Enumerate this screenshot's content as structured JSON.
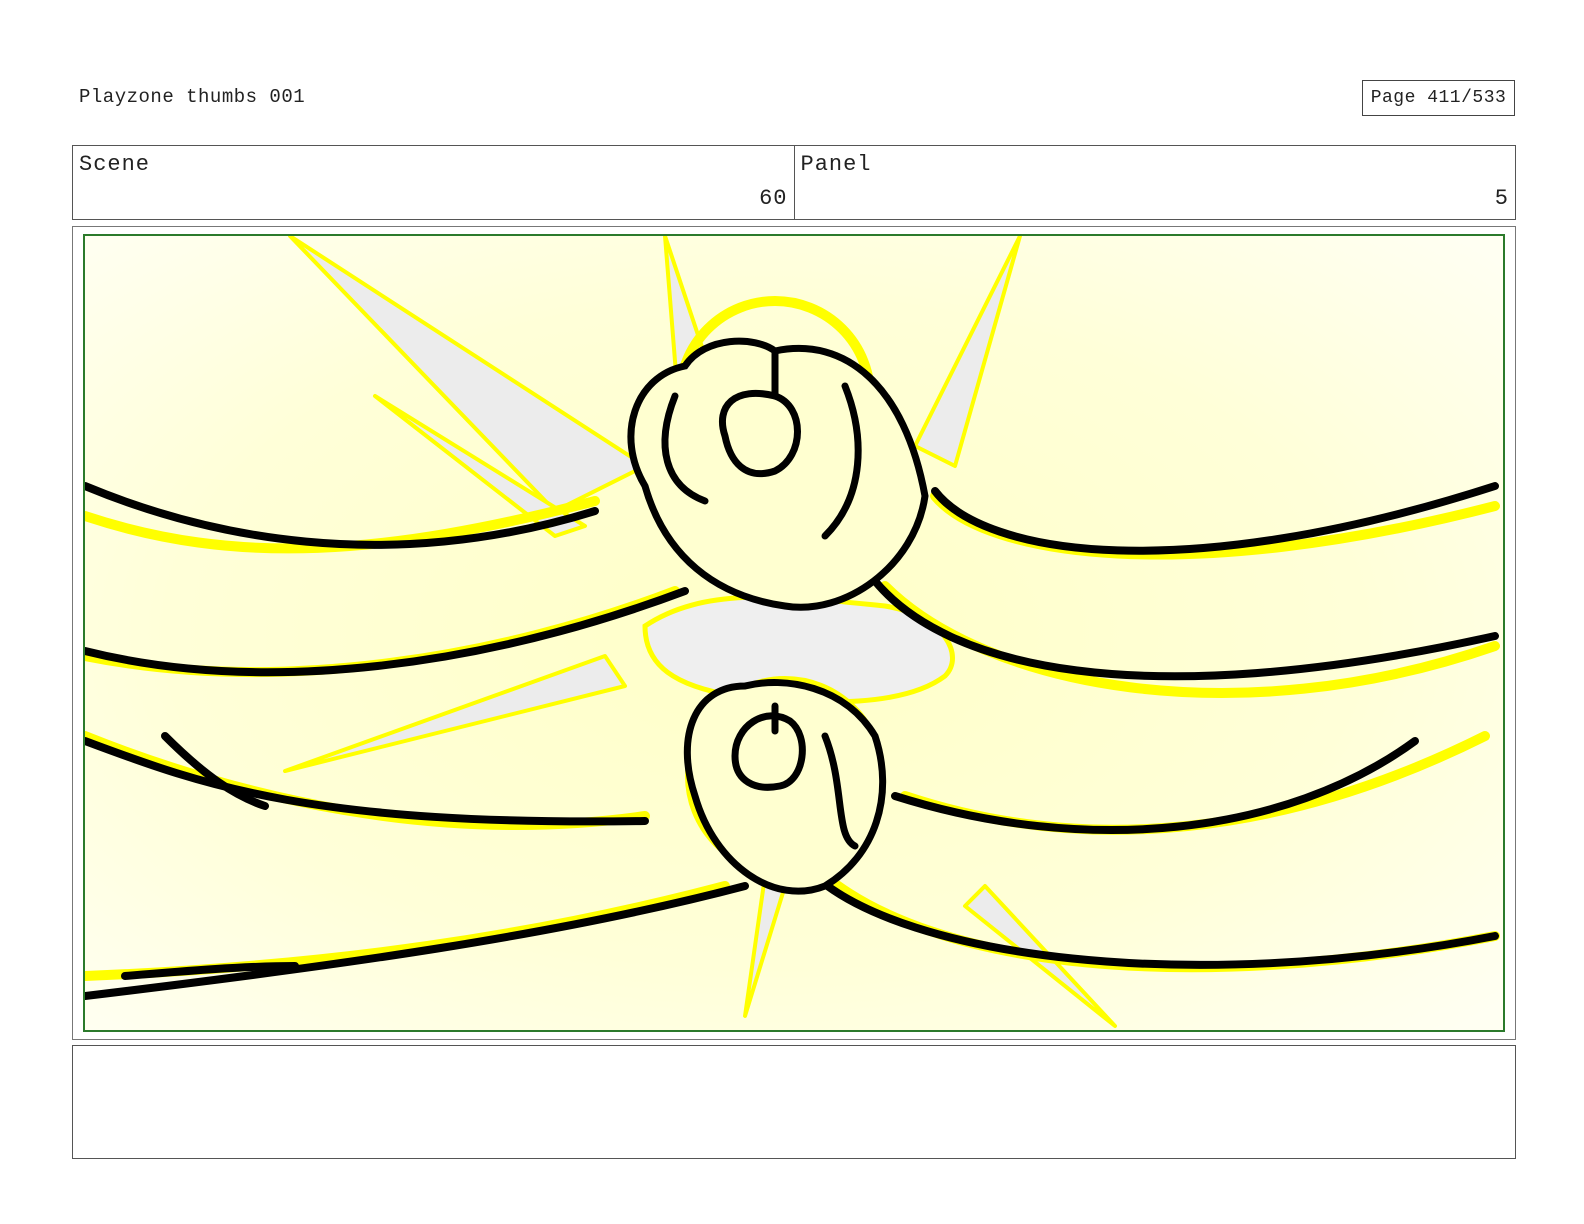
{
  "header": {
    "title": "Playzone thumbs 001",
    "page_label": "Page 411/533"
  },
  "info": {
    "scene_label": "Scene",
    "scene_value": "60",
    "panel_label": "Panel",
    "panel_value": "5"
  },
  "panel_art": {
    "description_icon": "storyboard-sketch-clasped-hands",
    "colors": {
      "background": "#fffed6",
      "highlight": "#ffff00",
      "ink": "#000000",
      "gap_fill": "#eeeeee",
      "frame_border": "#2b7a2b"
    }
  },
  "notes": {
    "text": ""
  }
}
